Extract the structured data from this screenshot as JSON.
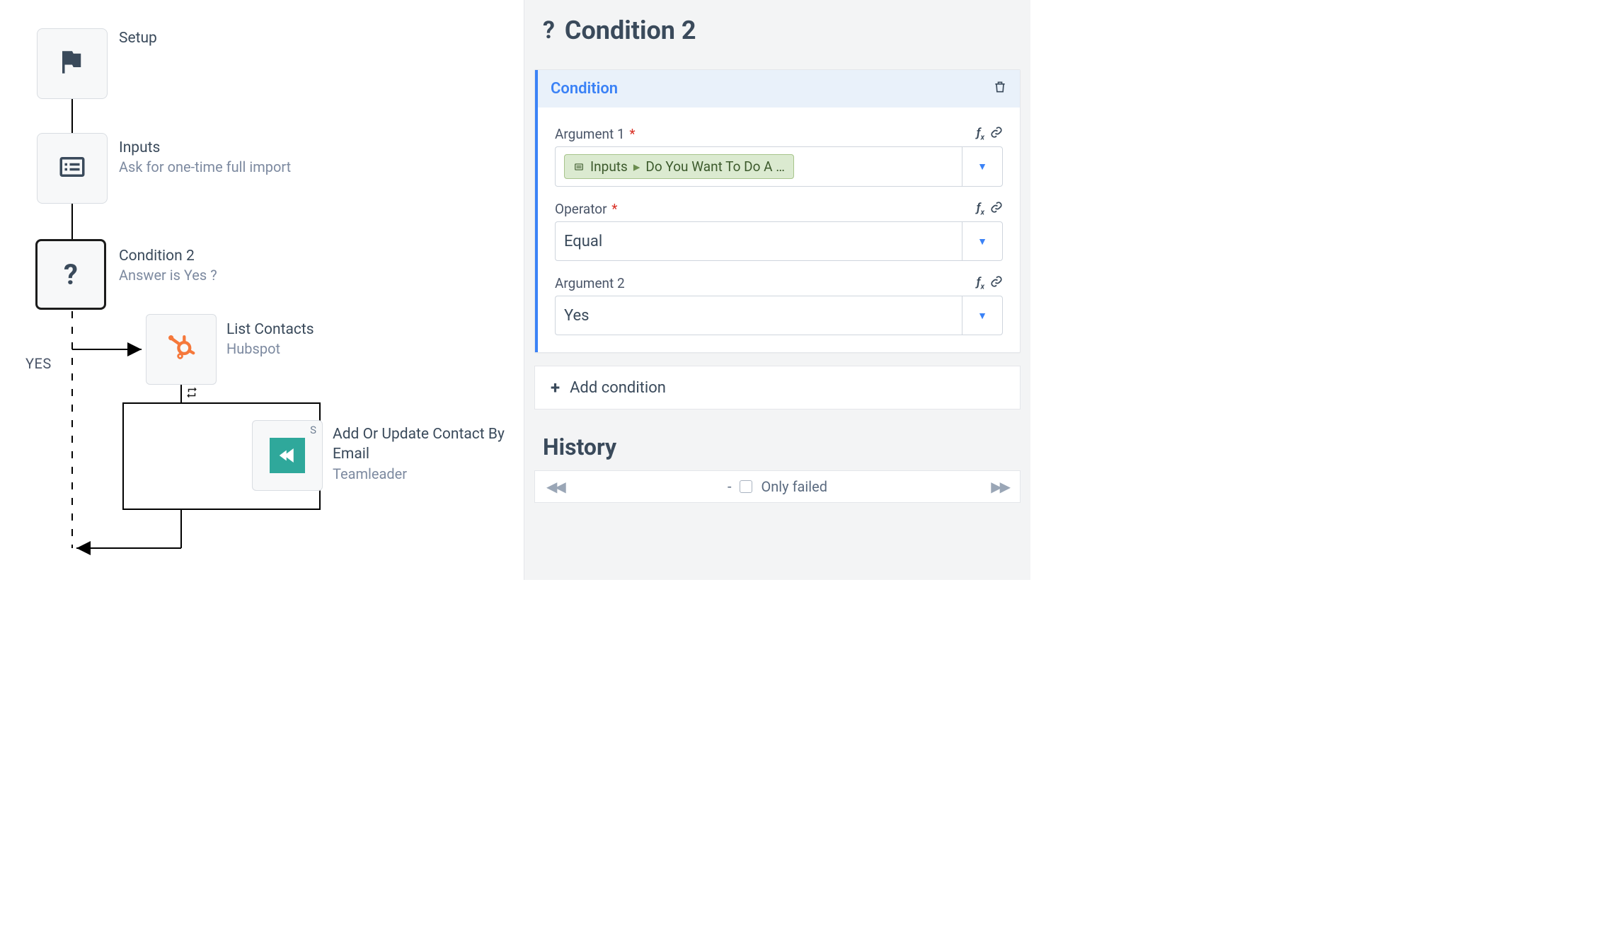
{
  "flow": {
    "nodes": {
      "setup": {
        "title": "Setup",
        "subtitle": ""
      },
      "inputs": {
        "title": "Inputs",
        "subtitle": "Ask for one-time full import"
      },
      "cond2": {
        "title": "Condition 2",
        "subtitle": "Answer is Yes ?"
      },
      "hubspot": {
        "title": "List Contacts",
        "subtitle": "Hubspot"
      },
      "teamleader": {
        "title": "Add Or Update Contact By Email",
        "subtitle": "Teamleader",
        "badge": "S"
      }
    },
    "yes_label": "YES"
  },
  "panel": {
    "title": "Condition 2",
    "section_title": "Condition",
    "fields": {
      "arg1": {
        "label": "Argument 1",
        "required": true,
        "pill_source": "Inputs",
        "pill_value": "Do You Want To Do A …"
      },
      "operator": {
        "label": "Operator",
        "required": true,
        "value": "Equal"
      },
      "arg2": {
        "label": "Argument 2",
        "required": false,
        "value": "Yes"
      }
    },
    "add_condition": "Add condition",
    "history": {
      "title": "History",
      "dash": "-",
      "only_failed": "Only failed"
    },
    "tools": {
      "fx": "ƒₓ",
      "link": "🔗"
    }
  }
}
